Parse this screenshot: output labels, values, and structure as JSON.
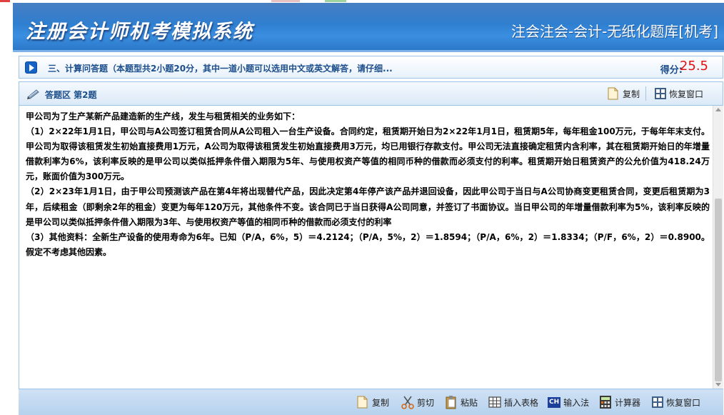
{
  "header": {
    "app_title": "注册会计师机考模拟系统",
    "subject_title": "注会注会-会计-无纸化题库[机考]"
  },
  "question_bar": {
    "section_title": "三、计算问答题（本题型共2小题20分，其中一道小题可以选用中文或英文解答，请仔细...",
    "score_label": "得分:",
    "score_value": "25.5"
  },
  "answer_bar": {
    "title": "答题区 第2题",
    "copy_label": "复制",
    "restore_label": "恢复窗口"
  },
  "question": {
    "paragraphs": [
      "甲公司为了生产某新产品建造新的生产线，发生与租赁相关的业务如下：",
      "（1）2×22年1月1日，甲公司与A公司签订租赁合同从A公司租入一台生产设备。合同约定，租赁期开始日为2×22年1月1日，租赁期5年，每年租金100万元，于每年年末支付。甲公司为取得该租赁发生初始直接费用1万元，A公司为取得该租赁发生初始直接费用3万元，均已用银行存款支付。甲公司无法直接确定租赁内含利率，其在租赁期开始日的年增量借款利率为6%，该利率反映的是甲公司以类似抵押条件借入期限为5年、与使用权资产等值的相同币种的借款而必须支付的利率。租赁期开始日租赁资产的公允价值为418.24万元，账面价值为300万元。",
      "（2）2×23年1月1日，由于甲公司预测该产品在第4年将出现替代产品，因此决定第4年停产该产品并退回设备，因此甲公司于当日与A公司协商变更租赁合同，变更后租赁期为3年，后续租金（即剩余2年的租金）变更为每年120万元，其他条件不变。该合同已于当日获得A公司同意，并签订了书面协议。当日甲公司的年增量借款利率为5%，该利率反映的是甲公司以类似抵押条件借入期限为3年、与使用权资产等值的相同币种的借款而必须支付的利率",
      "（3）其他资料：全新生产设备的使用寿命为6年。已知（P/A，6%，5）＝4.2124；（P/A，5%，2）＝1.8594；（P/A，6%，2）＝1.8334；（P/F，6%，2）＝0.8900。假定不考虑其他因素。"
    ]
  },
  "bottom_toolbar": {
    "copy": "复制",
    "cut": "剪切",
    "paste": "粘贴",
    "insert_table": "插入表格",
    "input_method": "输入法",
    "input_method_badge": "CH",
    "calculator": "计算器",
    "restore": "恢复窗口"
  },
  "colors": {
    "header_blue": "#2f7fd0",
    "title_text": "#1c4e8c",
    "score_red": "#e01010"
  }
}
